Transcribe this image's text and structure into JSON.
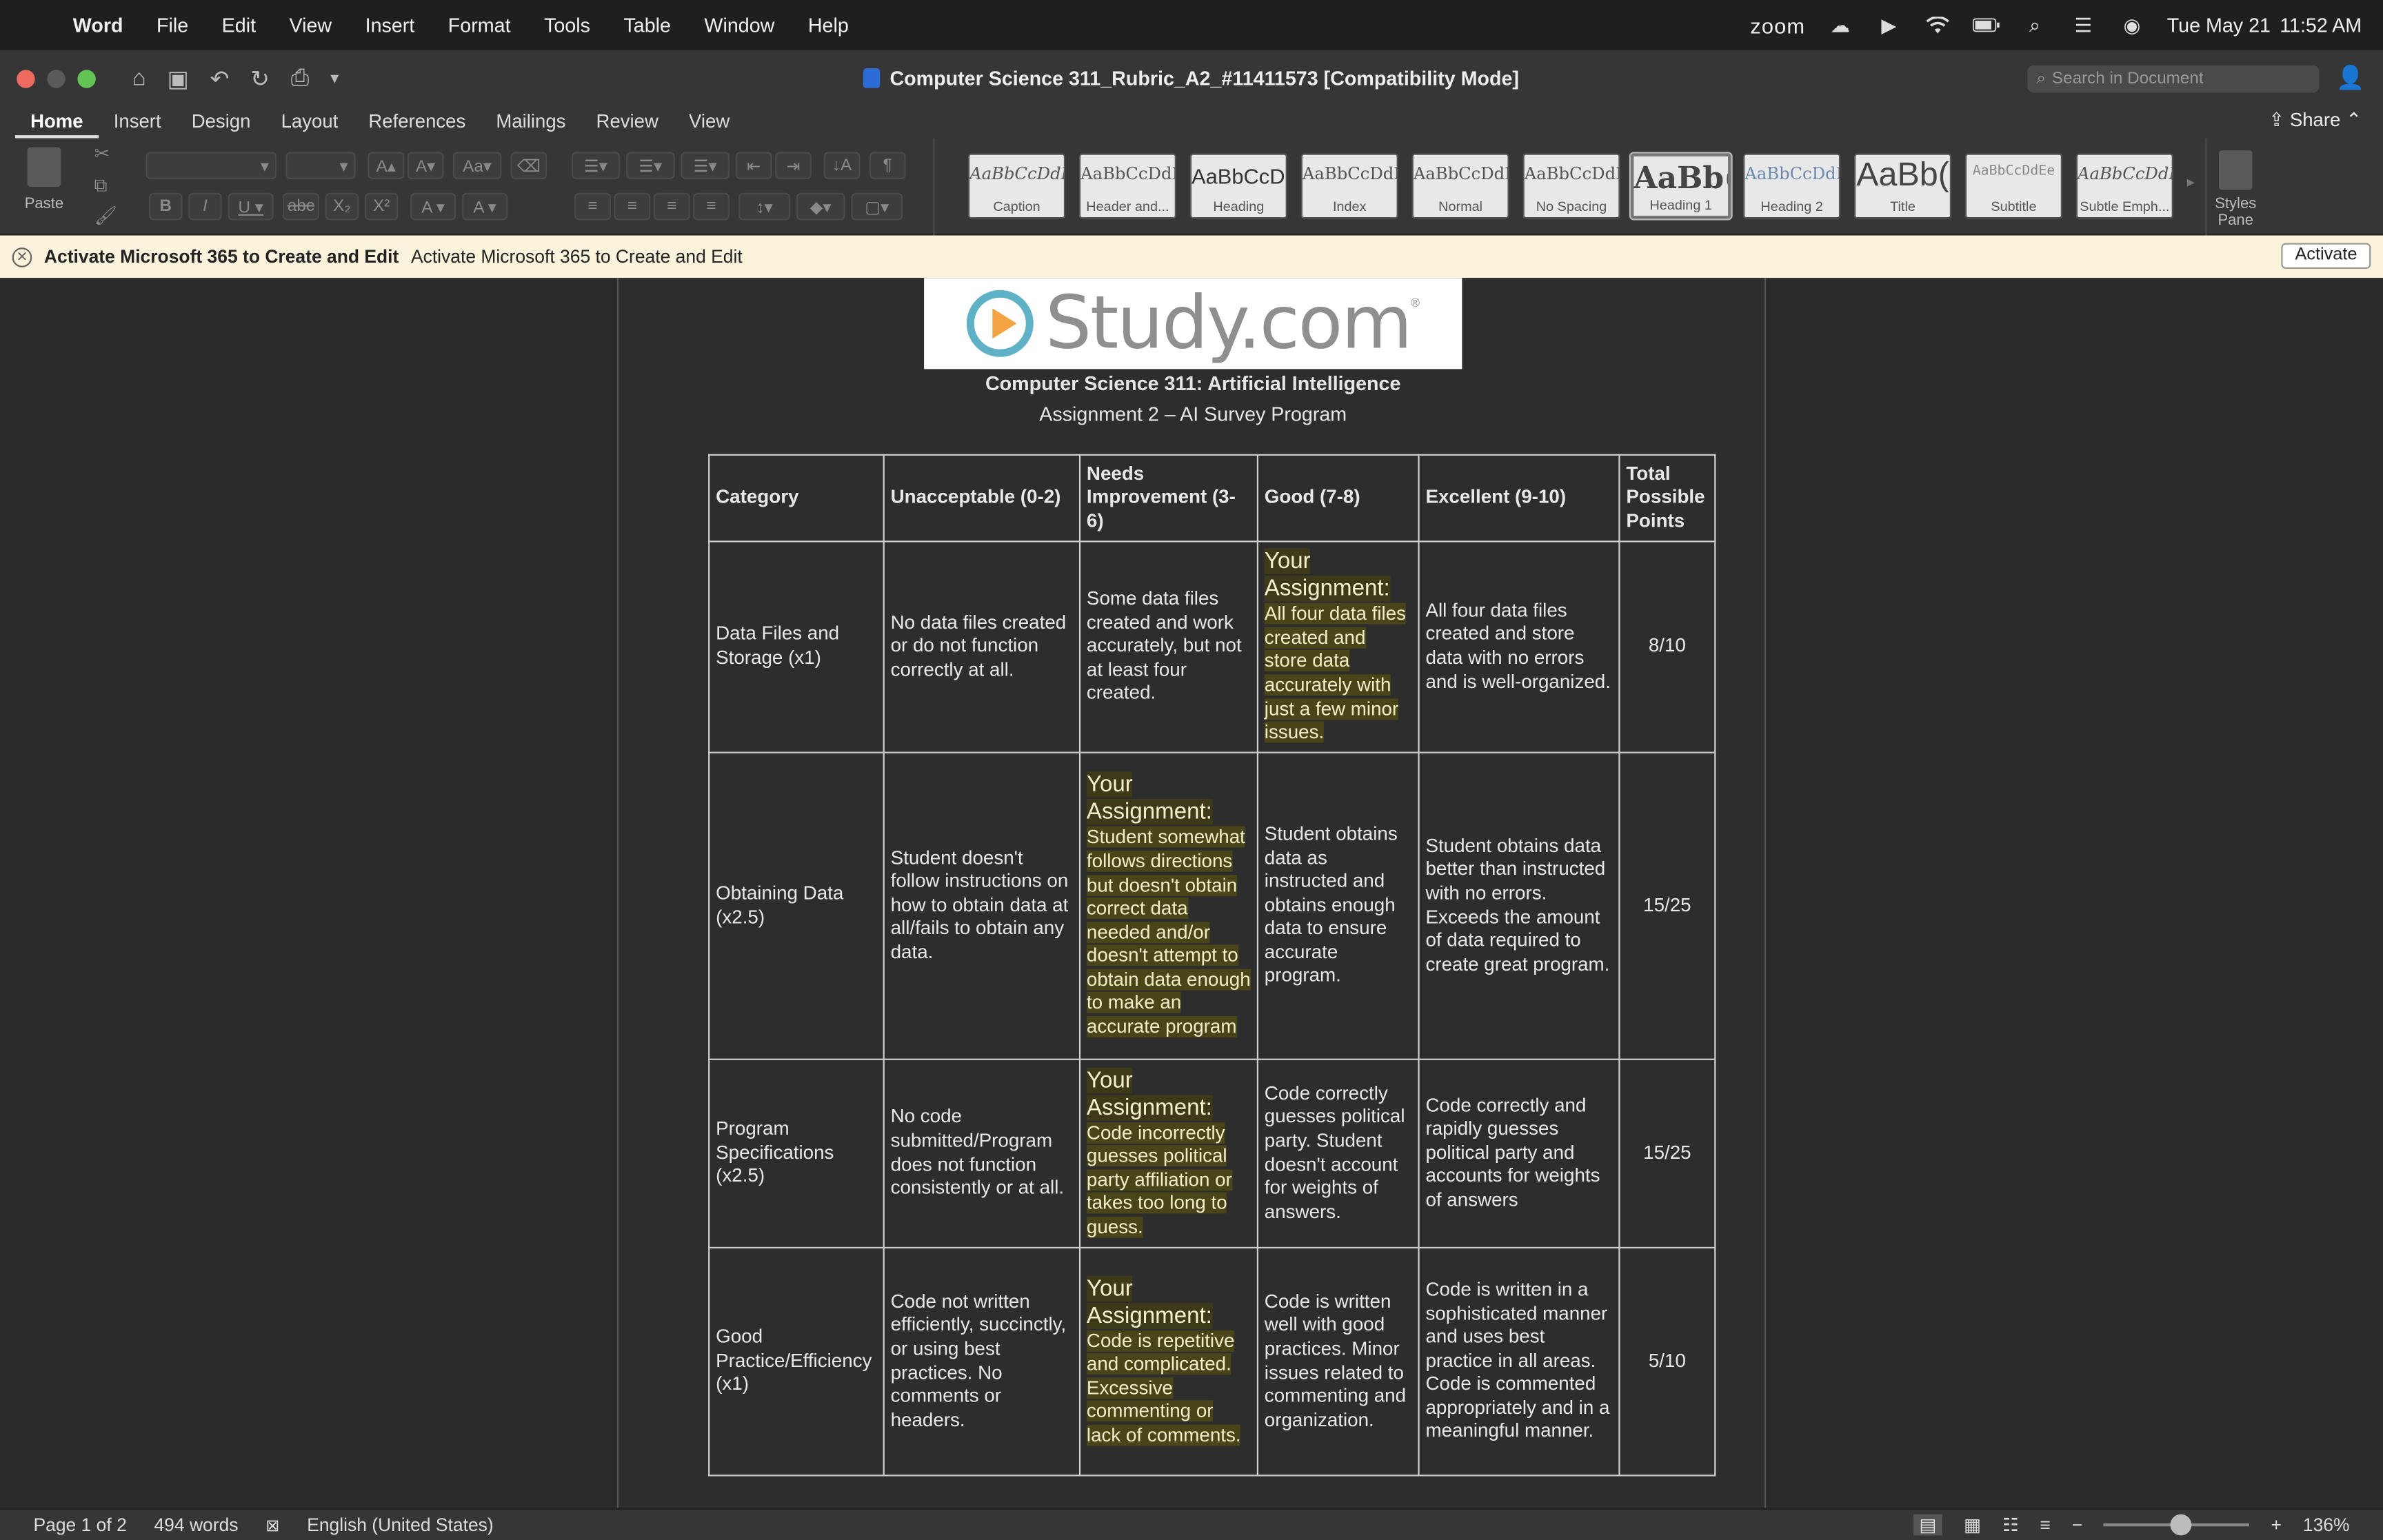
{
  "menubar": {
    "app": "Word",
    "items": [
      "File",
      "Edit",
      "View",
      "Insert",
      "Format",
      "Tools",
      "Table",
      "Window",
      "Help"
    ],
    "zoom": "zoom",
    "date": "Tue May 21",
    "time": "11:52 AM"
  },
  "window": {
    "title": "Computer Science 311_Rubric_A2_#11411573 [Compatibility Mode]",
    "search_placeholder": "Search in Document"
  },
  "tabs": [
    "Home",
    "Insert",
    "Design",
    "Layout",
    "References",
    "Mailings",
    "Review",
    "View"
  ],
  "share_label": "Share",
  "ribbon": {
    "paste_label": "Paste",
    "styles_pane_label": "Styles Pane",
    "styles": [
      {
        "preview": "AaBbCcDdEe",
        "name": "Caption"
      },
      {
        "preview": "AaBbCcDdEe",
        "name": "Header and..."
      },
      {
        "preview": "AaBbCcDd",
        "name": "Heading"
      },
      {
        "preview": "AaBbCcDdEe",
        "name": "Index"
      },
      {
        "preview": "AaBbCcDdEe",
        "name": "Normal"
      },
      {
        "preview": "AaBbCcDdEe",
        "name": "No Spacing"
      },
      {
        "preview": "AaBb(",
        "name": "Heading 1"
      },
      {
        "preview": "AaBbCcDdEe",
        "name": "Heading 2"
      },
      {
        "preview": "AaBb(",
        "name": "Title"
      },
      {
        "preview": "AaBbCcDdEe",
        "name": "Subtitle"
      },
      {
        "preview": "AaBbCcDdEe",
        "name": "Subtle Emph..."
      }
    ]
  },
  "notice": {
    "bold_text": "Activate Microsoft 365 to Create and Edit",
    "text": "Activate Microsoft 365 to Create and Edit",
    "button": "Activate"
  },
  "document": {
    "logo_text": "Study.com",
    "course_title": "Computer Science 311: Artificial Intelligence",
    "assignment_title": "Assignment 2 – AI Survey Program",
    "headers": [
      "Category",
      "Unacceptable (0-2)",
      "Needs Improvement (3-6)",
      "Good (7-8)",
      "Excellent (9-10)",
      "Total Possible Points"
    ],
    "your_assignment_label": "Your Assignment:",
    "rows": [
      {
        "category": "Data Files and Storage (x1)",
        "unacceptable": "No data files created or do not function correctly at all.",
        "needs": "Some data files created and work accurately, but not at least four created.",
        "good": "All four data files created and store data accurately with just a few minor issues.",
        "excellent": "All four data files created and store data with no errors and is well-organized.",
        "points": "8/10",
        "highlight": "good"
      },
      {
        "category": "Obtaining Data (x2.5)",
        "unacceptable": "Student doesn't follow instructions on how to obtain data at all/fails to obtain any data.",
        "needs": "Student somewhat follows directions but doesn't obtain correct data needed and/or doesn't attempt to obtain data enough to make an accurate program",
        "good": "Student obtains data as instructed and obtains enough data to ensure accurate program.",
        "excellent": "Student obtains data better than instructed with no errors. Exceeds the amount of data required to create great program.",
        "points": "15/25",
        "highlight": "needs"
      },
      {
        "category": "Program Specifications (x2.5)",
        "unacceptable": "No code submitted/Program does not function consistently or at all.",
        "needs": "Code incorrectly guesses political party affiliation or takes too long to guess.",
        "good": "Code correctly guesses political party. Student doesn't account for weights of answers.",
        "excellent": "Code correctly and rapidly guesses political party and accounts for weights of answers",
        "points": "15/25",
        "highlight": "needs"
      },
      {
        "category": "Good Practice/Efficiency (x1)",
        "unacceptable": "Code not written efficiently, succinctly, or using best practices. No comments or headers.",
        "needs": "Code is repetitive and complicated. Excessive commenting or lack of comments.",
        "good": "Code is written well with good practices. Minor issues related to commenting and organization.",
        "excellent": "Code is written in a sophisticated manner and uses best practice in all areas. Code is commented appropriately and in a meaningful manner.",
        "points": "5/10",
        "highlight": "needs"
      }
    ]
  },
  "status": {
    "page": "Page 1 of 2",
    "words": "494 words",
    "language": "English (United States)",
    "zoom": "136%"
  }
}
